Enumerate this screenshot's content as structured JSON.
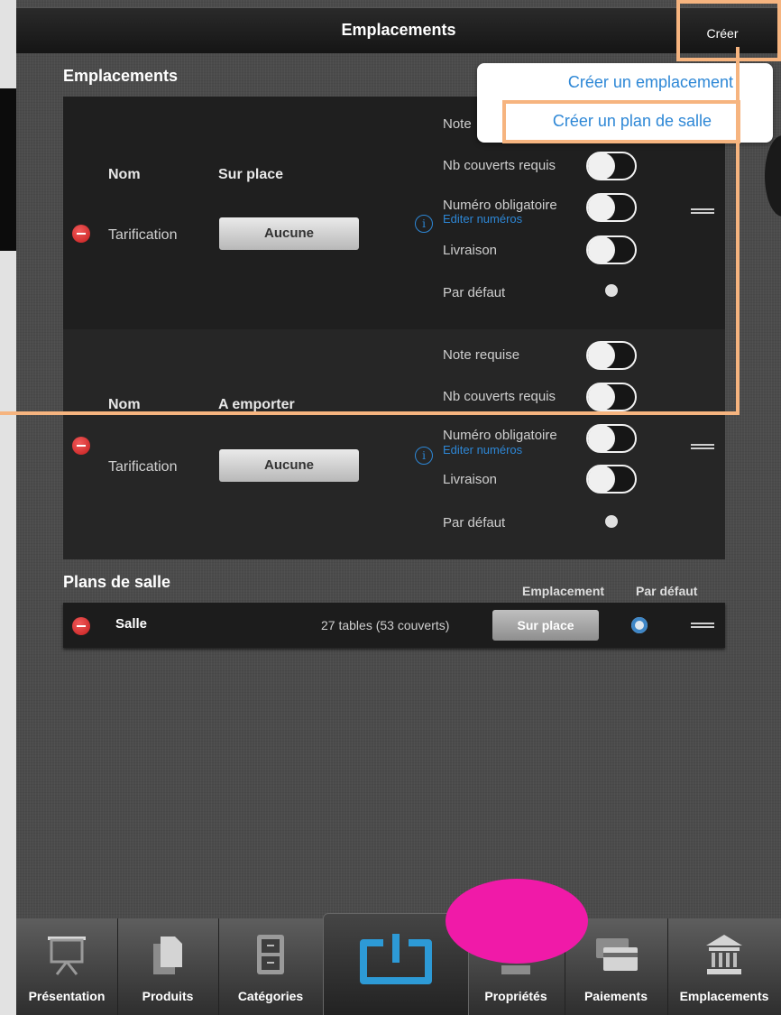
{
  "topbar": {
    "title": "Emplacements",
    "create_label": "Créer"
  },
  "popover": {
    "items": [
      "Créer un emplacement",
      "Créer un plan de salle"
    ]
  },
  "emplacements": {
    "section_title": "Emplacements",
    "rows": [
      {
        "name_label": "Nom",
        "name_value": "Sur place",
        "pricing_label": "Tarification",
        "pricing_value": "Aucune",
        "note_label": "Note",
        "covers_label": "Nb couverts requis",
        "number_label": "Numéro obligatoire",
        "edit_numbers": "Editer numéros",
        "delivery_label": "Livraison",
        "default_label": "Par défaut"
      },
      {
        "name_label": "Nom",
        "name_value": "A emporter",
        "pricing_label": "Tarification",
        "pricing_value": "Aucune",
        "note_label": "Note requise",
        "covers_label": "Nb couverts requis",
        "number_label": "Numéro obligatoire",
        "edit_numbers": "Editer numéros",
        "delivery_label": "Livraison",
        "default_label": "Par défaut"
      }
    ]
  },
  "plans": {
    "section_title": "Plans de salle",
    "col_location": "Emplacement",
    "col_default": "Par défaut",
    "rows": [
      {
        "name": "Salle",
        "summary": "27 tables (53 couverts)",
        "location": "Sur place"
      }
    ]
  },
  "tabs": [
    {
      "label": "Présentation",
      "icon": "presentation-board-icon"
    },
    {
      "label": "Produits",
      "icon": "documents-icon"
    },
    {
      "label": "Catégories",
      "icon": "cabinet-icon"
    },
    {
      "label": "",
      "icon": "power-icon"
    },
    {
      "label": "Propriétés",
      "icon": "properties-icon"
    },
    {
      "label": "Paiements",
      "icon": "cards-icon"
    },
    {
      "label": "Emplacements",
      "icon": "building-icon"
    }
  ],
  "colors": {
    "accent": "#2d87d6",
    "highlight": "#f6b47f",
    "delete": "#d93030",
    "annotation_blob": "#f01aa8"
  }
}
